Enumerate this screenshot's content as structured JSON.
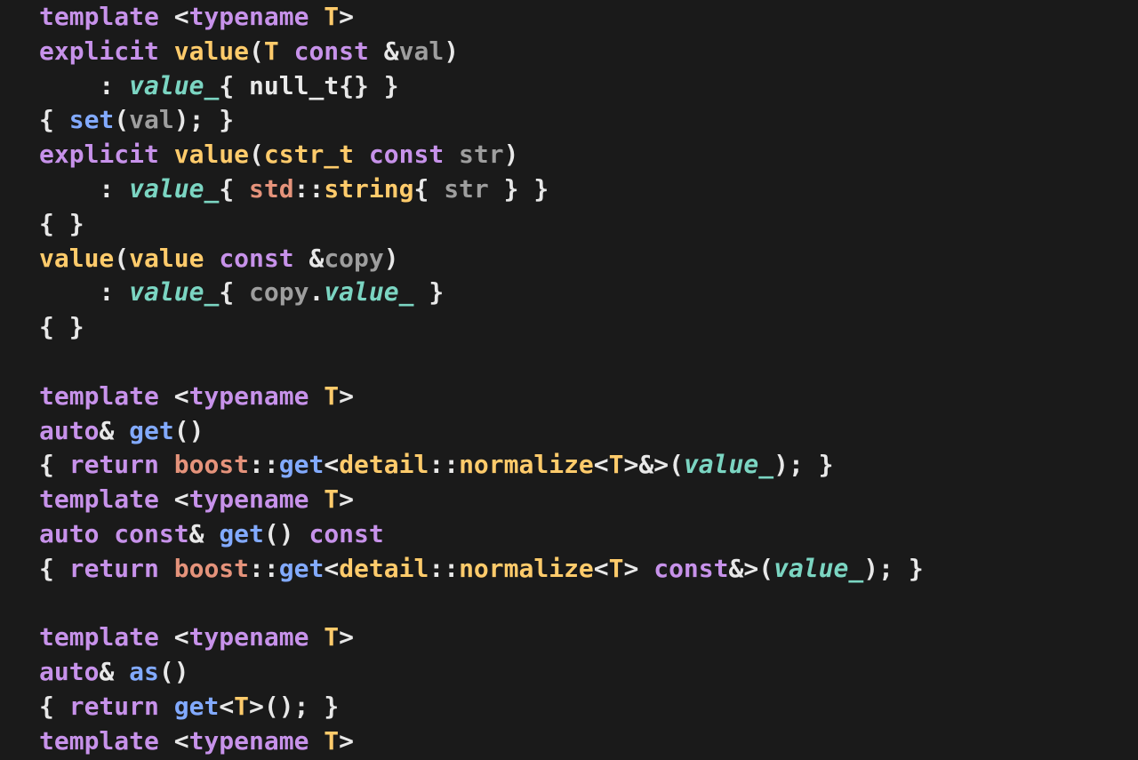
{
  "lines": [
    [
      {
        "t": "template ",
        "c": "kw"
      },
      {
        "t": "<",
        "c": "white"
      },
      {
        "t": "typename ",
        "c": "kw"
      },
      {
        "t": "T",
        "c": "type"
      },
      {
        "t": ">",
        "c": "white"
      }
    ],
    [
      {
        "t": "explicit ",
        "c": "kw"
      },
      {
        "t": "value",
        "c": "type"
      },
      {
        "t": "(",
        "c": "white"
      },
      {
        "t": "T ",
        "c": "type"
      },
      {
        "t": "const ",
        "c": "kw"
      },
      {
        "t": "&",
        "c": "white"
      },
      {
        "t": "val",
        "c": "dim"
      },
      {
        "t": ")",
        "c": "white"
      }
    ],
    [
      {
        "t": "    : ",
        "c": "white"
      },
      {
        "t": "value_",
        "c": "mem"
      },
      {
        "t": "{ ",
        "c": "white"
      },
      {
        "t": "null_t",
        "c": "null"
      },
      {
        "t": "{} }",
        "c": "white"
      }
    ],
    [
      {
        "t": "{ ",
        "c": "white"
      },
      {
        "t": "set",
        "c": "func"
      },
      {
        "t": "(",
        "c": "white"
      },
      {
        "t": "val",
        "c": "dim"
      },
      {
        "t": "); }",
        "c": "white"
      }
    ],
    [
      {
        "t": "explicit ",
        "c": "kw"
      },
      {
        "t": "value",
        "c": "type"
      },
      {
        "t": "(",
        "c": "white"
      },
      {
        "t": "cstr_t ",
        "c": "type"
      },
      {
        "t": "const ",
        "c": "kw"
      },
      {
        "t": "str",
        "c": "dim"
      },
      {
        "t": ")",
        "c": "white"
      }
    ],
    [
      {
        "t": "    : ",
        "c": "white"
      },
      {
        "t": "value_",
        "c": "mem"
      },
      {
        "t": "{ ",
        "c": "white"
      },
      {
        "t": "std",
        "c": "ns"
      },
      {
        "t": "::",
        "c": "white"
      },
      {
        "t": "string",
        "c": "type"
      },
      {
        "t": "{ ",
        "c": "white"
      },
      {
        "t": "str",
        "c": "dim"
      },
      {
        "t": " } }",
        "c": "white"
      }
    ],
    [
      {
        "t": "{ }",
        "c": "white"
      }
    ],
    [
      {
        "t": "value",
        "c": "type"
      },
      {
        "t": "(",
        "c": "white"
      },
      {
        "t": "value ",
        "c": "type"
      },
      {
        "t": "const ",
        "c": "kw"
      },
      {
        "t": "&",
        "c": "white"
      },
      {
        "t": "copy",
        "c": "dim"
      },
      {
        "t": ")",
        "c": "white"
      }
    ],
    [
      {
        "t": "    : ",
        "c": "white"
      },
      {
        "t": "value_",
        "c": "mem"
      },
      {
        "t": "{ ",
        "c": "white"
      },
      {
        "t": "copy",
        "c": "dim"
      },
      {
        "t": ".",
        "c": "white"
      },
      {
        "t": "value_",
        "c": "mem"
      },
      {
        "t": " }",
        "c": "white"
      }
    ],
    [
      {
        "t": "{ }",
        "c": "white"
      }
    ],
    [
      {
        "t": "",
        "c": "white"
      }
    ],
    [
      {
        "t": "template ",
        "c": "kw"
      },
      {
        "t": "<",
        "c": "white"
      },
      {
        "t": "typename ",
        "c": "kw"
      },
      {
        "t": "T",
        "c": "type"
      },
      {
        "t": ">",
        "c": "white"
      }
    ],
    [
      {
        "t": "auto",
        "c": "kw"
      },
      {
        "t": "& ",
        "c": "white"
      },
      {
        "t": "get",
        "c": "func"
      },
      {
        "t": "()",
        "c": "white"
      }
    ],
    [
      {
        "t": "{ ",
        "c": "white"
      },
      {
        "t": "return ",
        "c": "kw"
      },
      {
        "t": "boost",
        "c": "ns"
      },
      {
        "t": "::",
        "c": "white"
      },
      {
        "t": "get",
        "c": "func"
      },
      {
        "t": "<",
        "c": "white"
      },
      {
        "t": "detail",
        "c": "type"
      },
      {
        "t": "::",
        "c": "white"
      },
      {
        "t": "normalize",
        "c": "type"
      },
      {
        "t": "<",
        "c": "white"
      },
      {
        "t": "T",
        "c": "type"
      },
      {
        "t": ">&>(",
        "c": "white"
      },
      {
        "t": "value_",
        "c": "mem"
      },
      {
        "t": "); }",
        "c": "white"
      }
    ],
    [
      {
        "t": "template ",
        "c": "kw"
      },
      {
        "t": "<",
        "c": "white"
      },
      {
        "t": "typename ",
        "c": "kw"
      },
      {
        "t": "T",
        "c": "type"
      },
      {
        "t": ">",
        "c": "white"
      }
    ],
    [
      {
        "t": "auto ",
        "c": "kw"
      },
      {
        "t": "const",
        "c": "kw"
      },
      {
        "t": "& ",
        "c": "white"
      },
      {
        "t": "get",
        "c": "func"
      },
      {
        "t": "() ",
        "c": "white"
      },
      {
        "t": "const",
        "c": "kw"
      }
    ],
    [
      {
        "t": "{ ",
        "c": "white"
      },
      {
        "t": "return ",
        "c": "kw"
      },
      {
        "t": "boost",
        "c": "ns"
      },
      {
        "t": "::",
        "c": "white"
      },
      {
        "t": "get",
        "c": "func"
      },
      {
        "t": "<",
        "c": "white"
      },
      {
        "t": "detail",
        "c": "type"
      },
      {
        "t": "::",
        "c": "white"
      },
      {
        "t": "normalize",
        "c": "type"
      },
      {
        "t": "<",
        "c": "white"
      },
      {
        "t": "T",
        "c": "type"
      },
      {
        "t": "> ",
        "c": "white"
      },
      {
        "t": "const",
        "c": "kw"
      },
      {
        "t": "&>(",
        "c": "white"
      },
      {
        "t": "value_",
        "c": "mem"
      },
      {
        "t": "); }",
        "c": "white"
      }
    ],
    [
      {
        "t": "",
        "c": "white"
      }
    ],
    [
      {
        "t": "template ",
        "c": "kw"
      },
      {
        "t": "<",
        "c": "white"
      },
      {
        "t": "typename ",
        "c": "kw"
      },
      {
        "t": "T",
        "c": "type"
      },
      {
        "t": ">",
        "c": "white"
      }
    ],
    [
      {
        "t": "auto",
        "c": "kw"
      },
      {
        "t": "& ",
        "c": "white"
      },
      {
        "t": "as",
        "c": "func"
      },
      {
        "t": "()",
        "c": "white"
      }
    ],
    [
      {
        "t": "{ ",
        "c": "white"
      },
      {
        "t": "return ",
        "c": "kw"
      },
      {
        "t": "get",
        "c": "func"
      },
      {
        "t": "<",
        "c": "white"
      },
      {
        "t": "T",
        "c": "type"
      },
      {
        "t": ">(); }",
        "c": "white"
      }
    ],
    [
      {
        "t": "template ",
        "c": "kw"
      },
      {
        "t": "<",
        "c": "white"
      },
      {
        "t": "typename ",
        "c": "kw"
      },
      {
        "t": "T",
        "c": "type"
      },
      {
        "t": ">",
        "c": "white"
      }
    ]
  ]
}
